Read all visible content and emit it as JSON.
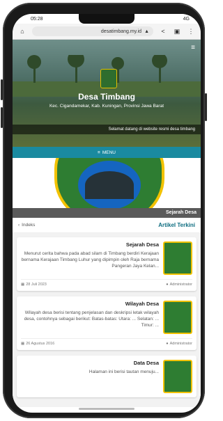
{
  "status": {
    "time": "05:28",
    "carrier": "4G"
  },
  "browser": {
    "url": "desatimbang.my.id"
  },
  "hero": {
    "title": "Desa Timbang",
    "subtitle": "Kec. Cigandamekar, Kab. Kuningan, Provinsi Jawa Barat",
    "marquee": "Selamat datang di website resmi desa timbang"
  },
  "menu": {
    "label": "MENU"
  },
  "banner": {
    "caption": "Sejarah Desa"
  },
  "section": {
    "title": "Artikel Terkini",
    "index_label": "Indeks"
  },
  "articles": [
    {
      "title": "Sejarah Desa",
      "text": "Menurut cerita bahwa pada abad silam di Timbang berdiri Kerajaan bernama Kerajaan Timbang Luhur yang dipimpin oleh Raja bernama Pangeran Jaya Kelan...",
      "date": "28 Juli 2023",
      "author": "Administrator"
    },
    {
      "title": "Wilayah Desa",
      "text": "Wilayah desa berisi tentang penjelasan dan deskripsi letak wilayah desa, contohnya sebagai berikut: Batas-batas: Utara: ... Selatan: ... Timur: ...",
      "date": "26 Agustus 2016",
      "author": "Administrator"
    },
    {
      "title": "Data Desa",
      "text": "Halaman ini berisi tautan menuju...",
      "date": "",
      "author": ""
    }
  ]
}
